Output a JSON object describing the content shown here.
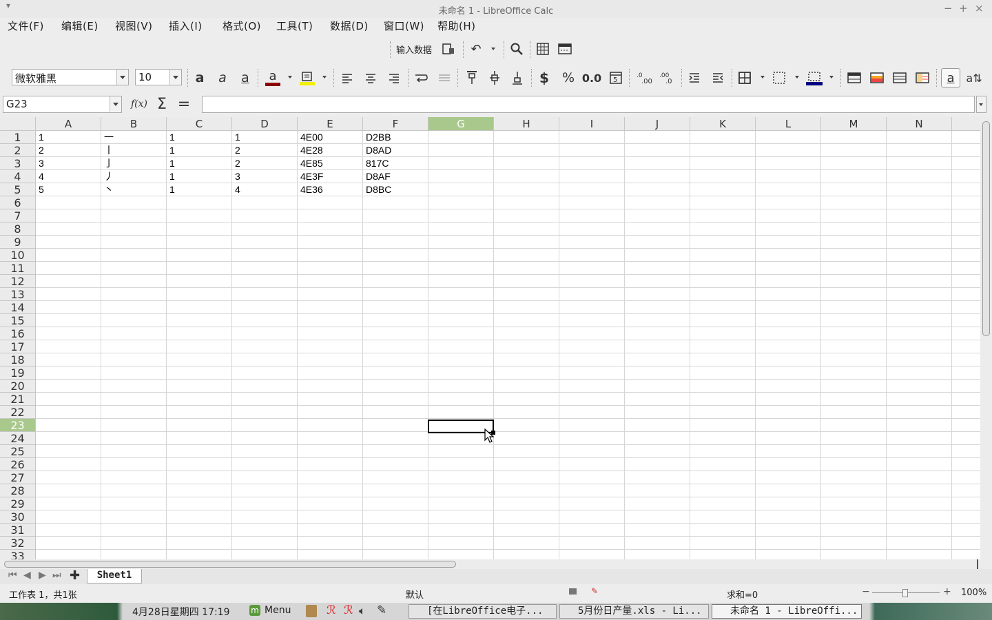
{
  "window": {
    "title": "未命名 1 - LibreOffice Calc"
  },
  "menu": [
    "文件(F)",
    "编辑(E)",
    "视图(V)",
    "插入(I)",
    "格式(O)",
    "工具(T)",
    "数据(D)",
    "窗口(W)",
    "帮助(H)"
  ],
  "toolbar": {
    "input_data_label": "输入数据"
  },
  "format": {
    "font_name": "微软雅黑",
    "font_size": "10",
    "font_color": "#8b0000",
    "highlight_color": "#f0f000",
    "border_color": "#000080"
  },
  "formula": {
    "name_box": "G23",
    "fx_label": "f(x)",
    "sum_symbol": "Σ",
    "equals_symbol": "=",
    "content": ""
  },
  "columns": [
    "A",
    "B",
    "C",
    "D",
    "E",
    "F",
    "G",
    "H",
    "I",
    "J",
    "K",
    "L",
    "M",
    "N"
  ],
  "selected_column": "G",
  "selected_row": "23",
  "rows": [
    "1",
    "2",
    "3",
    "4",
    "5",
    "6",
    "7",
    "8",
    "9",
    "10",
    "11",
    "12",
    "13",
    "14",
    "15",
    "16",
    "17",
    "18",
    "19",
    "20",
    "21",
    "22",
    "23",
    "24",
    "25",
    "26",
    "27",
    "28",
    "29",
    "30",
    "31",
    "32",
    "33"
  ],
  "cells": [
    [
      "1",
      "一",
      "1",
      "1",
      "4E00",
      "D2BB"
    ],
    [
      "2",
      "丨",
      "1",
      "2",
      "4E28",
      "D8AD"
    ],
    [
      "3",
      "亅",
      "1",
      "2",
      "4E85",
      "817C"
    ],
    [
      "4",
      "丿",
      "1",
      "3",
      "4E3F",
      "D8AF"
    ],
    [
      "5",
      "丶",
      "1",
      "4",
      "4E36",
      "D8BC"
    ]
  ],
  "sheet_tab": "Sheet1",
  "status": {
    "sheet_info": "工作表 1，共1张",
    "page_style": "默认",
    "sum": "求和=0",
    "zoom": "100%"
  },
  "taskbar": {
    "clock": "4月28日星期四 17:19",
    "menu_label": "Menu",
    "tasks": [
      "[在LibreOffice电子...",
      "5月份日产量.xls - Li...",
      "未命名 1 - LibreOffi..."
    ]
  }
}
